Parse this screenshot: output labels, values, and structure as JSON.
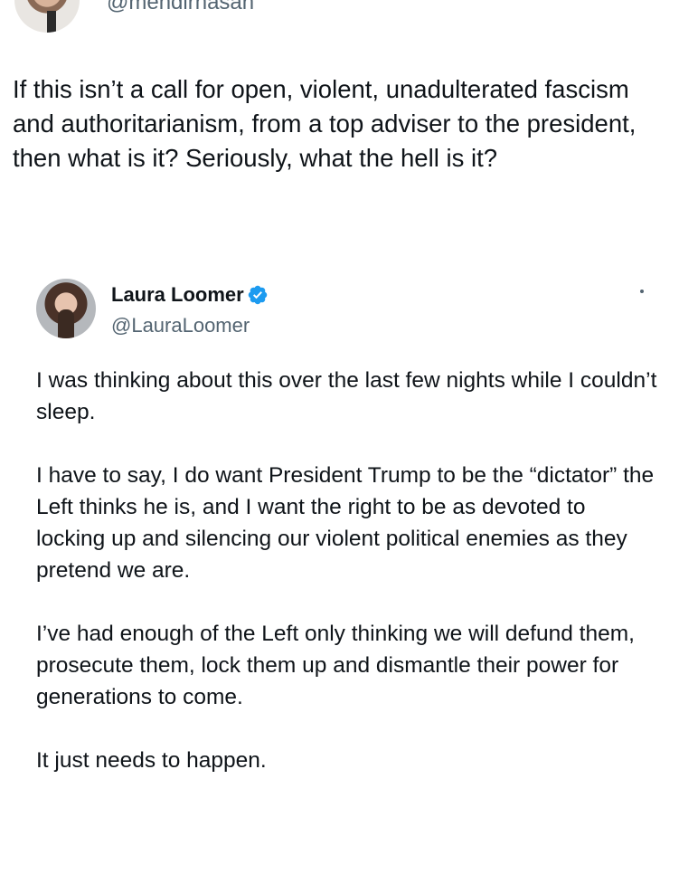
{
  "outer_tweet": {
    "handle": "@mehdirhasan",
    "text": "If this isn’t a call for open, violent, unadulterated fascism and authoritarianism, from a top adviser to the president, then what is it? Seriously, what the hell is it?"
  },
  "quoted_tweet": {
    "display_name": "Laura Loomer",
    "handle": "@LauraLoomer",
    "verified": true,
    "paragraphs": [
      "I was thinking about this over the last few nights while I couldn’t sleep.",
      "I have to say, I do want President Trump to be the “dictator” the Left thinks he is, and I want the right to be as devoted to locking up and silencing our violent political enemies as they pretend we are.",
      "I’ve had enough of the Left only thinking we will defund them, prosecute them, lock them up and dismantle their power for generations to come.",
      "It just needs to happen."
    ]
  },
  "colors": {
    "text_primary": "#0f1419",
    "text_secondary": "#536471",
    "verified_blue": "#1d9bf0"
  },
  "icons": {
    "verified": "verified-badge-icon",
    "more": "more-options-icon"
  }
}
